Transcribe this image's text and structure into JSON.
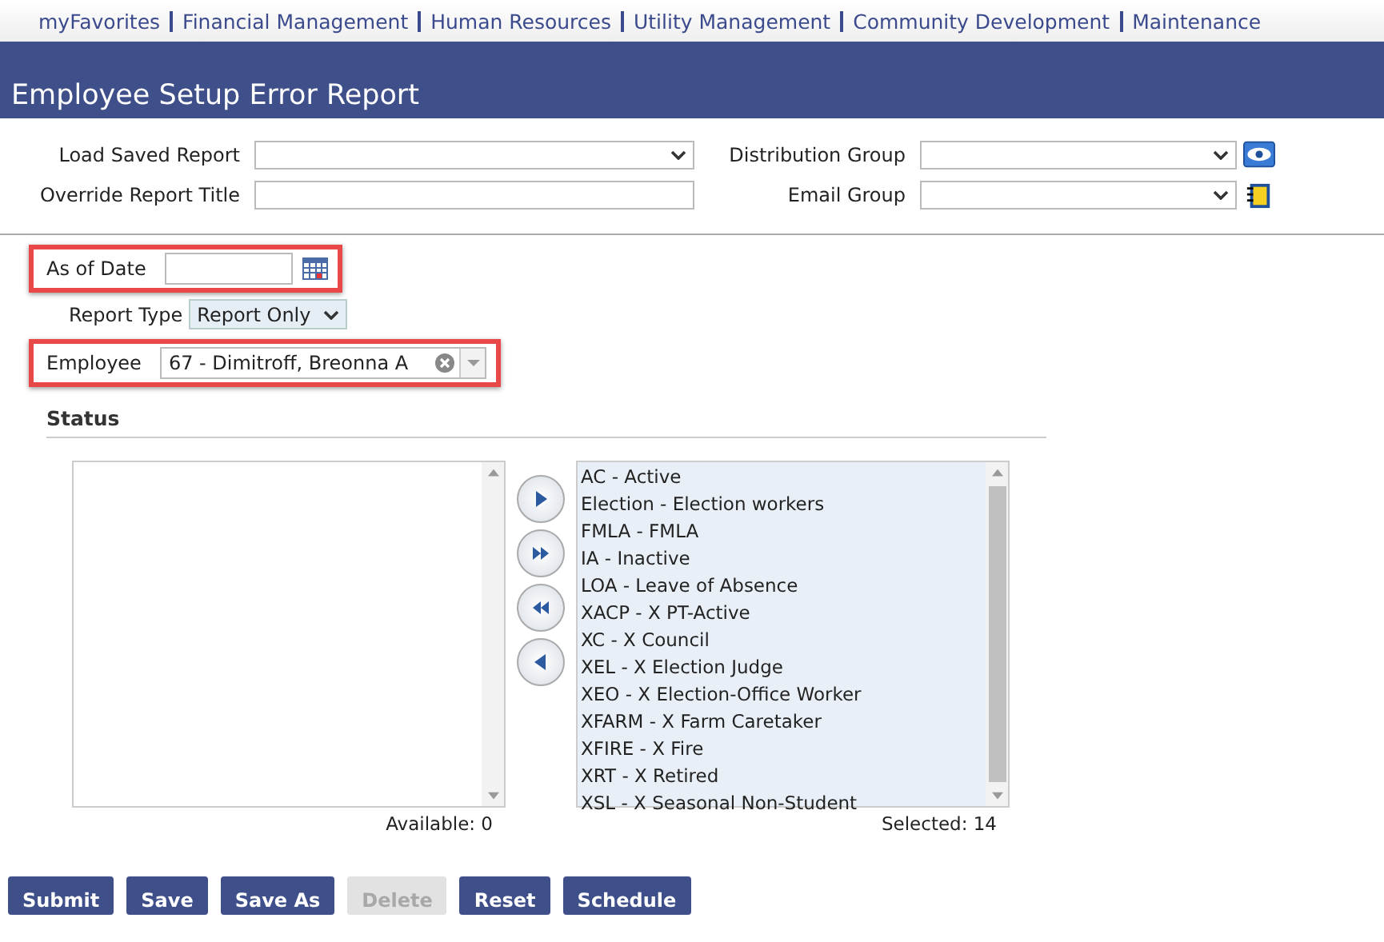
{
  "nav": [
    "myFavorites",
    "Financial Management",
    "Human Resources",
    "Utility Management",
    "Community Development",
    "Maintenance"
  ],
  "page_title": "Employee Setup Error Report",
  "load_saved_report": {
    "label": "Load Saved Report"
  },
  "override_report_title": {
    "label": "Override Report Title"
  },
  "distribution_group": {
    "label": "Distribution Group"
  },
  "email_group": {
    "label": "Email Group"
  },
  "as_of_date": {
    "label": "As of Date"
  },
  "report_type": {
    "label": "Report Type",
    "value": "Report Only"
  },
  "employee": {
    "label": "Employee",
    "value": "67 - Dimitroff, Breonna A"
  },
  "status": {
    "heading": "Status",
    "available_label": "Available: 0",
    "selected_label": "Selected: 14",
    "selected_items": [
      "AC - Active",
      "Election - Election workers",
      "FMLA - FMLA",
      "IA - Inactive",
      "LOA - Leave of Absence",
      "XACP - X PT-Active",
      "XC - X Council",
      "XEL - X Election Judge",
      "XEO - X Election-Office Worker",
      "XFARM - X Farm Caretaker",
      "XFIRE - X Fire",
      "XRT - X Retired",
      "XSL - X Seasonal Non-Student"
    ]
  },
  "buttons": [
    {
      "label": "Submit",
      "disabled": false
    },
    {
      "label": "Save",
      "disabled": false
    },
    {
      "label": "Save As",
      "disabled": false
    },
    {
      "label": "Delete",
      "disabled": true
    },
    {
      "label": "Reset",
      "disabled": false
    },
    {
      "label": "Schedule",
      "disabled": false
    }
  ]
}
